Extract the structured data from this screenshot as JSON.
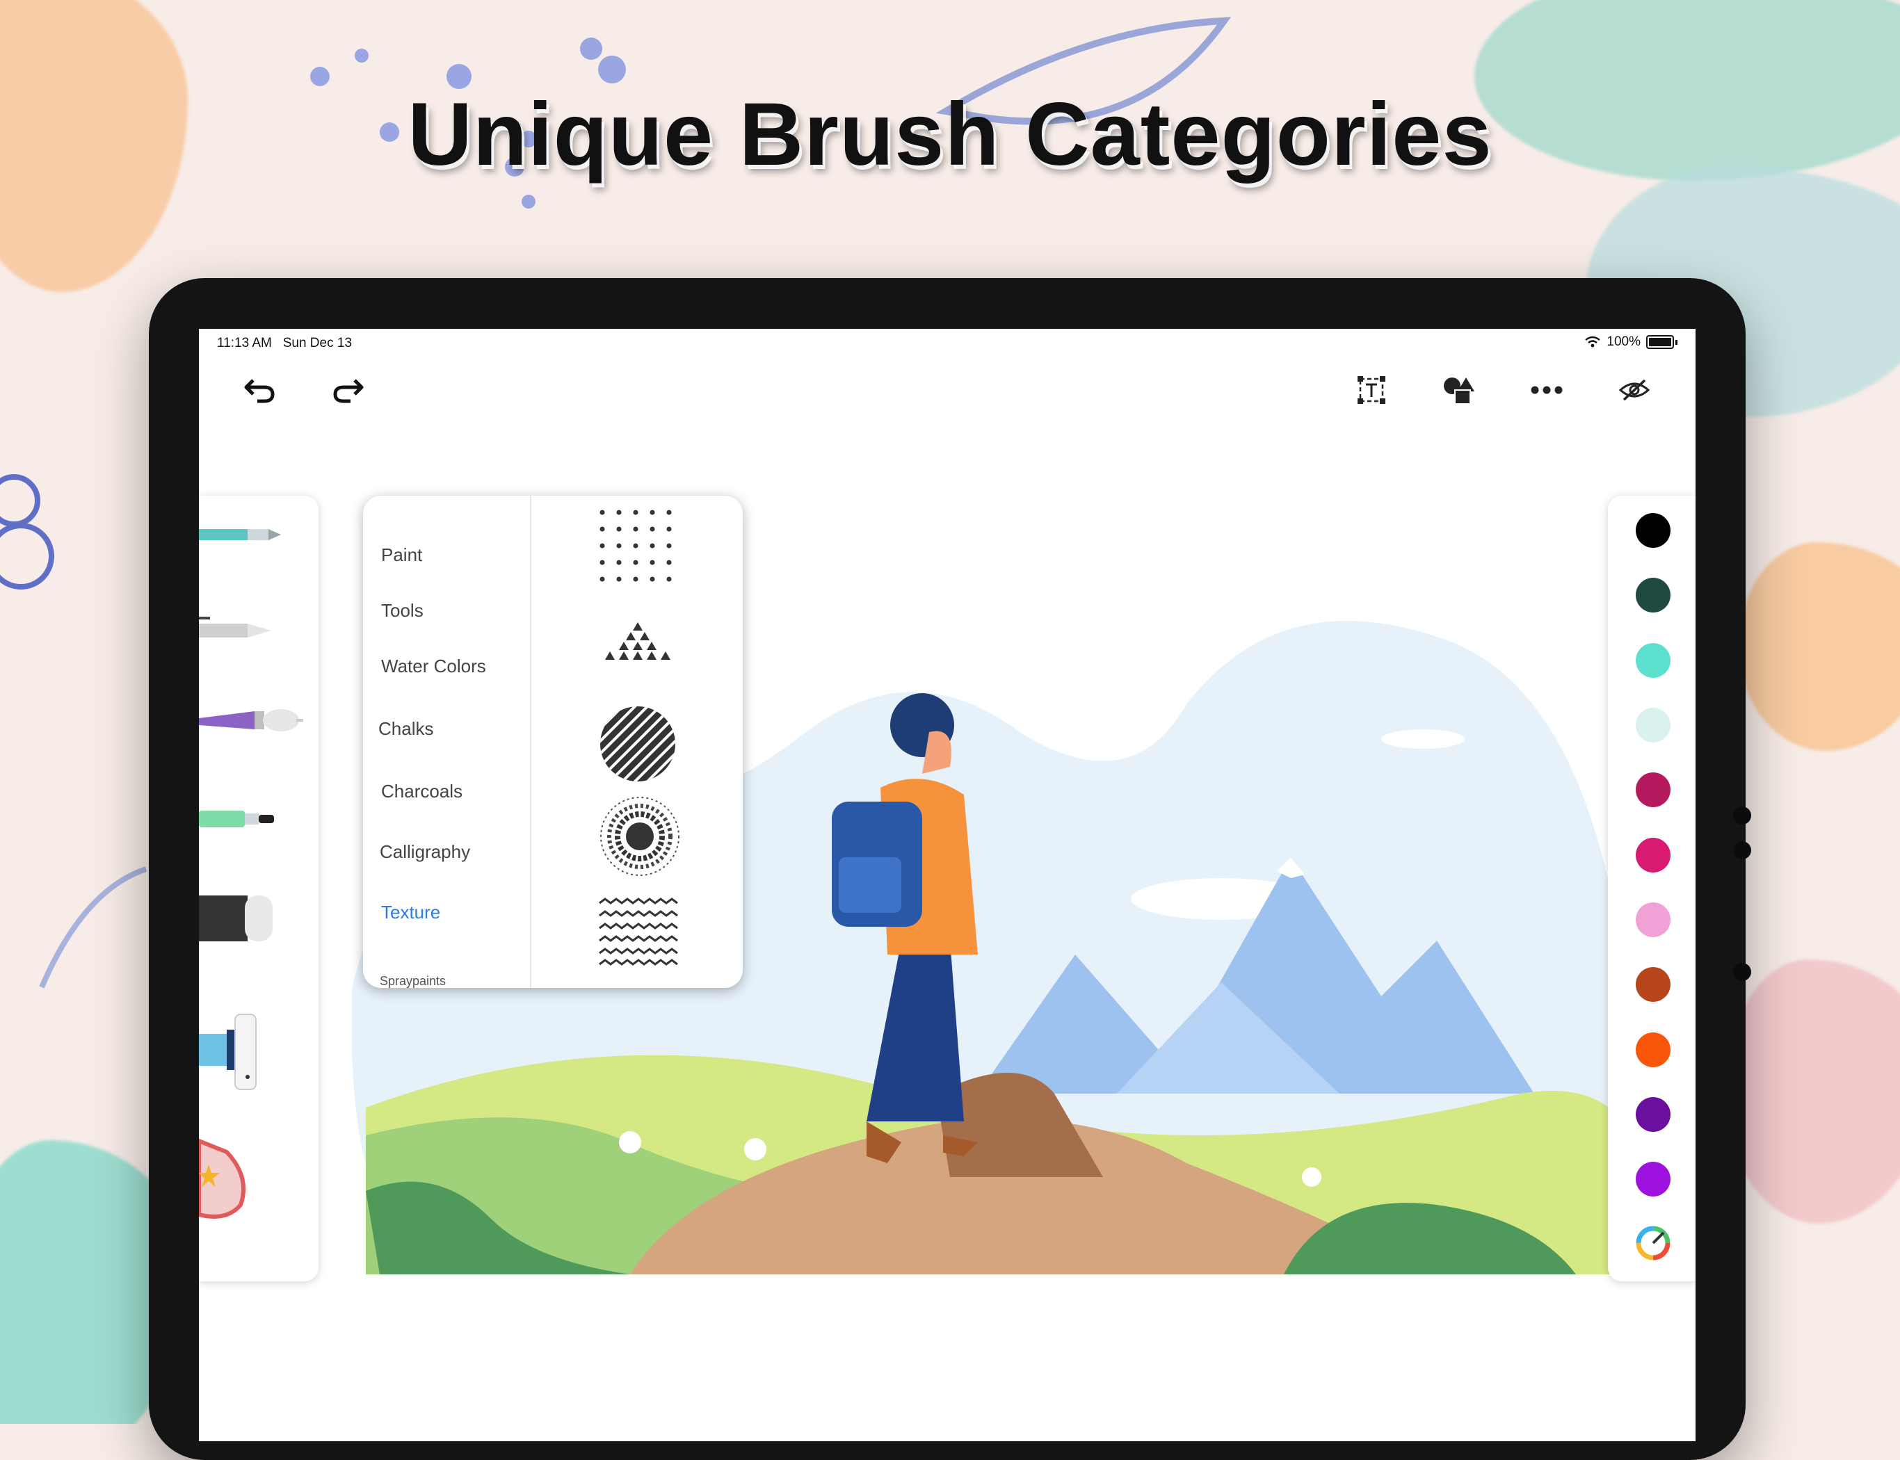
{
  "headline": "Unique Brush Categories",
  "status": {
    "time": "11:13 AM",
    "date": "Sun Dec 13",
    "battery": "100%"
  },
  "toolbar": {
    "left": [
      {
        "name": "undo-icon"
      },
      {
        "name": "redo-icon"
      }
    ],
    "right": [
      {
        "name": "text-tool-icon"
      },
      {
        "name": "shapes-icon"
      },
      {
        "name": "more-icon"
      },
      {
        "name": "hide-icon"
      }
    ]
  },
  "brush_tools": [
    {
      "name": "pencil-brush-icon"
    },
    {
      "name": "gray-pencil-brush-icon"
    },
    {
      "name": "round-brush-icon"
    },
    {
      "name": "marker-brush-icon"
    },
    {
      "name": "eraser-brush-icon"
    },
    {
      "name": "spray-tool-icon"
    },
    {
      "name": "sticker-tool-icon"
    }
  ],
  "brush_categories": {
    "items": [
      "Paint",
      "Tools",
      "Water Colors",
      "Chalks",
      "Charcoals",
      "Calligraphy",
      "Texture"
    ],
    "active_index": 6,
    "partial_item": "Spraypaints"
  },
  "texture_patterns": [
    "dots-grid",
    "triangles",
    "diagonal-stripes-circle",
    "halftone-circle",
    "zigzag-lines"
  ],
  "palette": {
    "colors": [
      "#000000",
      "#1f4a42",
      "#5ee0cf",
      "#d9f1ef",
      "#b41a5d",
      "#d81a72",
      "#f2a1d6",
      "#b8461c",
      "#f95609",
      "#6a0f9e",
      "#9e12e0"
    ],
    "picker": "color-wheel-icon"
  }
}
